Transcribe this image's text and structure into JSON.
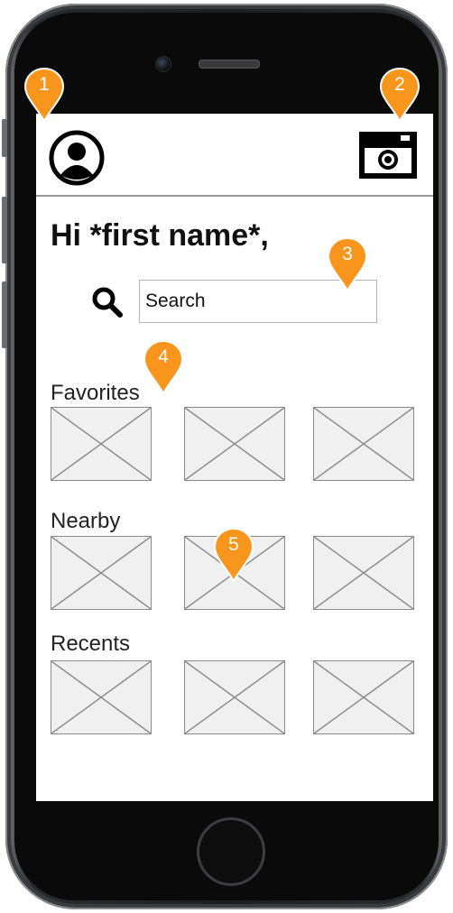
{
  "header": {
    "profile_icon": "user-avatar-icon",
    "camera_icon": "camera-icon"
  },
  "greeting": "Hi *first name*,",
  "search": {
    "icon": "magnifier-icon",
    "placeholder": "Search"
  },
  "sections": {
    "favorites": {
      "title": "Favorites",
      "items": 3
    },
    "nearby": {
      "title": "Nearby",
      "items": 3
    },
    "recents": {
      "title": "Recents",
      "items": 3
    }
  },
  "annotations": [
    "1",
    "2",
    "3",
    "4",
    "5"
  ],
  "colors": {
    "callout": "#f7951d",
    "placeholder_fill": "#f0f0f0",
    "placeholder_stroke": "#8a8a8a",
    "divider": "#9a9a9a"
  }
}
